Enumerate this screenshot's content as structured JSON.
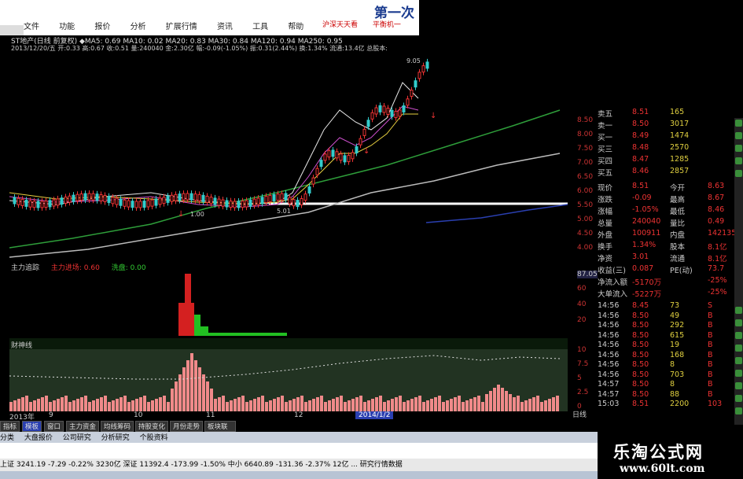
{
  "brand": {
    "top_title": "第一次",
    "watermark_title": "乐淘公式网",
    "watermark_url": "www.60lt.com"
  },
  "menu": [
    "文件",
    "功能",
    "报价",
    "分析",
    "扩展行情",
    "资讯",
    "工具",
    "帮助"
  ],
  "top_links": [
    "沪深天天看",
    "平衡机一"
  ],
  "main_chart": {
    "info_line": "ST地产(日线 前复权)  ◆MA5: 0.69  MA10: 0.02  MA20: 0.83  MA30: 0.84  MA120: 0.94  MA250: 0.95",
    "info_line2": "2013/12/20/五 开:0.33 高:0.67 收:0.51 量:240040 金:2.30亿 幅:-0.09(-1.05%) 振:0.31(2.44%) 换:1.34% 流通:13.4亿 总股本:",
    "annotations": [
      "1.00",
      "5.01",
      "9.05"
    ],
    "right_axis": [
      "8.50",
      "8.00",
      "7.50",
      "7.00",
      "6.50",
      "6.00",
      "5.50",
      "5.00",
      "4.50",
      "4.00"
    ]
  },
  "mid_indicator": {
    "name": "主力追踪",
    "line1": "主力进场: 0.60",
    "line2": "洗盘: 0.00",
    "axis": [
      "87.05",
      "60",
      "40",
      "20"
    ]
  },
  "vol_indicator": {
    "name": "财神线",
    "axis": [
      "10",
      "7.5",
      "5",
      "2.5",
      "0"
    ]
  },
  "x_axis": [
    "2013年",
    "9",
    "10",
    "11",
    "12",
    "2014/1/2"
  ],
  "right_tab": "日线",
  "chart_tabs": [
    "指标",
    "模板",
    "窗口",
    "主力资金",
    "均线筹码",
    "持股变化",
    "月份走势",
    "板块联动"
  ],
  "bottom_tabs": [
    "分类",
    "大盘报价",
    "公司研究",
    "分析研究",
    "个股资料"
  ],
  "status": "上证 3241.19  -7.29  -0.22%  3230亿  深证 11392.4  -173.99  -1.50%  中小 6640.89  -131.36  -2.37%  12亿  ...  研究行情数据",
  "quote": {
    "book": [
      [
        "卖五",
        "8.51",
        "165"
      ],
      [
        "卖一",
        "8.50",
        "3017"
      ],
      [
        "买一",
        "8.49",
        "1474"
      ],
      [
        "买三",
        "8.48",
        "2570"
      ],
      [
        "买四",
        "8.47",
        "1285"
      ],
      [
        "买五",
        "8.46",
        "2857"
      ]
    ],
    "stats": [
      [
        "现价",
        "8.51",
        "今开",
        "8.63"
      ],
      [
        "涨跌",
        "-0.09",
        "最高",
        "8.67"
      ],
      [
        "涨幅",
        "-1.05%",
        "最低",
        "8.46"
      ],
      [
        "总量",
        "240040",
        "量比",
        "0.49"
      ],
      [
        "外盘",
        "100911",
        "内盘",
        "142135"
      ],
      [
        "换手",
        "1.34%",
        "股本",
        "8.1亿"
      ],
      [
        "净资",
        "3.01",
        "流通",
        "8.1亿"
      ],
      [
        "收益(三)",
        "0.087",
        "PE(动)",
        "73.7"
      ],
      [
        "净流入额",
        "-5170万",
        "",
        "-25%"
      ],
      [
        "大单流入",
        "-5227万",
        "",
        "-25%"
      ]
    ],
    "ticks": [
      [
        "14:56",
        "8.45",
        "73",
        "S"
      ],
      [
        "14:56",
        "8.50",
        "49",
        "B"
      ],
      [
        "14:56",
        "8.50",
        "292",
        "B"
      ],
      [
        "14:56",
        "8.50",
        "615",
        "B"
      ],
      [
        "14:56",
        "8.50",
        "19",
        "B"
      ],
      [
        "14:56",
        "8.50",
        "168",
        "B"
      ],
      [
        "14:56",
        "8.50",
        "8",
        "B"
      ],
      [
        "14:56",
        "8.50",
        "703",
        "B"
      ],
      [
        "14:57",
        "8.50",
        "8",
        "B"
      ],
      [
        "14:57",
        "8.50",
        "88",
        "B"
      ],
      [
        "15:03",
        "8.51",
        "2200",
        "103"
      ]
    ]
  }
}
